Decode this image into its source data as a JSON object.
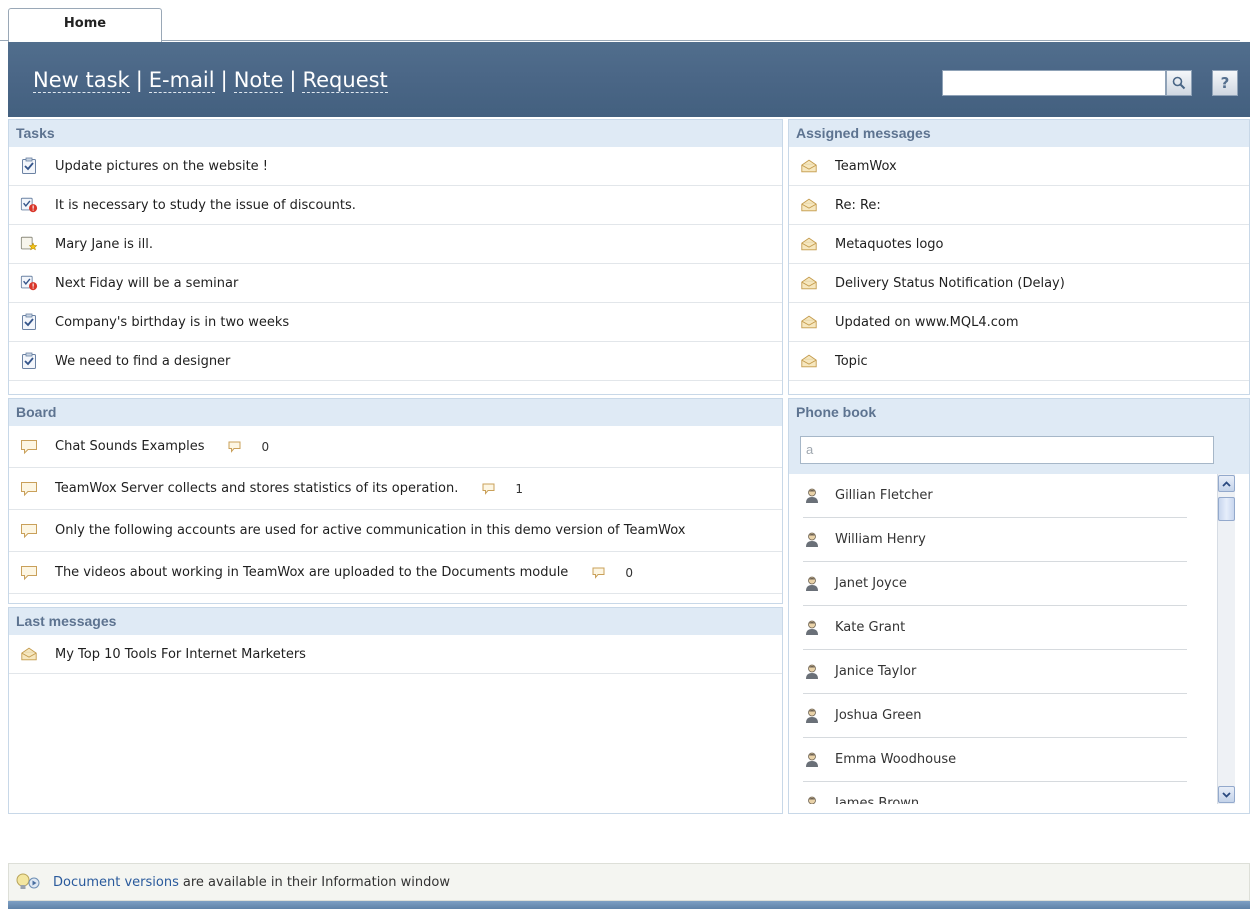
{
  "tabs": [
    {
      "label": "Home",
      "active": true
    }
  ],
  "header": {
    "actions": [
      "New task",
      "E-mail",
      "Note",
      "Request"
    ],
    "separator": "|",
    "search": {
      "value": "",
      "icon": "search-icon"
    },
    "help_label": "?"
  },
  "tasks": {
    "title": "Tasks",
    "items": [
      {
        "label": "Update pictures on the website !",
        "icon": "task-check-icon"
      },
      {
        "label": "It is necessary to study the issue of discounts.",
        "icon": "task-alert-icon"
      },
      {
        "label": "Mary Jane is ill.",
        "icon": "task-star-icon"
      },
      {
        "label": "Next Fiday will be a seminar",
        "icon": "task-alert-icon"
      },
      {
        "label": "Company's birthday is in two weeks",
        "icon": "task-check-icon"
      },
      {
        "label": "We need to find a designer",
        "icon": "task-check-icon"
      }
    ]
  },
  "assigned": {
    "title": "Assigned messages",
    "items": [
      {
        "label": "TeamWox"
      },
      {
        "label": "Re: Re:"
      },
      {
        "label": "Metaquotes logo"
      },
      {
        "label": "Delivery Status Notification (Delay)"
      },
      {
        "label": "Updated on www.MQL4.com"
      },
      {
        "label": "Topic"
      }
    ]
  },
  "board": {
    "title": "Board",
    "items": [
      {
        "label": "Chat Sounds Examples",
        "count": "0"
      },
      {
        "label": "TeamWox Server collects and stores statistics of its operation.",
        "count": "1"
      },
      {
        "label": "Only the following accounts are used for active communication in this demo version of TeamWox",
        "count": ""
      },
      {
        "label": "The videos about working in TeamWox are uploaded to the Documents module",
        "count": "0"
      }
    ]
  },
  "last_messages": {
    "title": "Last messages",
    "items": [
      {
        "label": "My Top 10 Tools For Internet Marketers"
      }
    ]
  },
  "phonebook": {
    "title": "Phone book",
    "search_value": "a",
    "contacts": [
      "Gillian Fletcher",
      "William Henry",
      "Janet Joyce",
      "Kate Grant",
      "Janice Taylor",
      "Joshua Green",
      "Emma Woodhouse",
      "James Brown"
    ]
  },
  "footer": {
    "link": "Document versions",
    "text": "are available in their Information window",
    "icon": "tip-bulb-icon"
  },
  "colors": {
    "header": "#4a6686",
    "panel_head": "#dfeaf5",
    "link": "#2a5a9c"
  }
}
